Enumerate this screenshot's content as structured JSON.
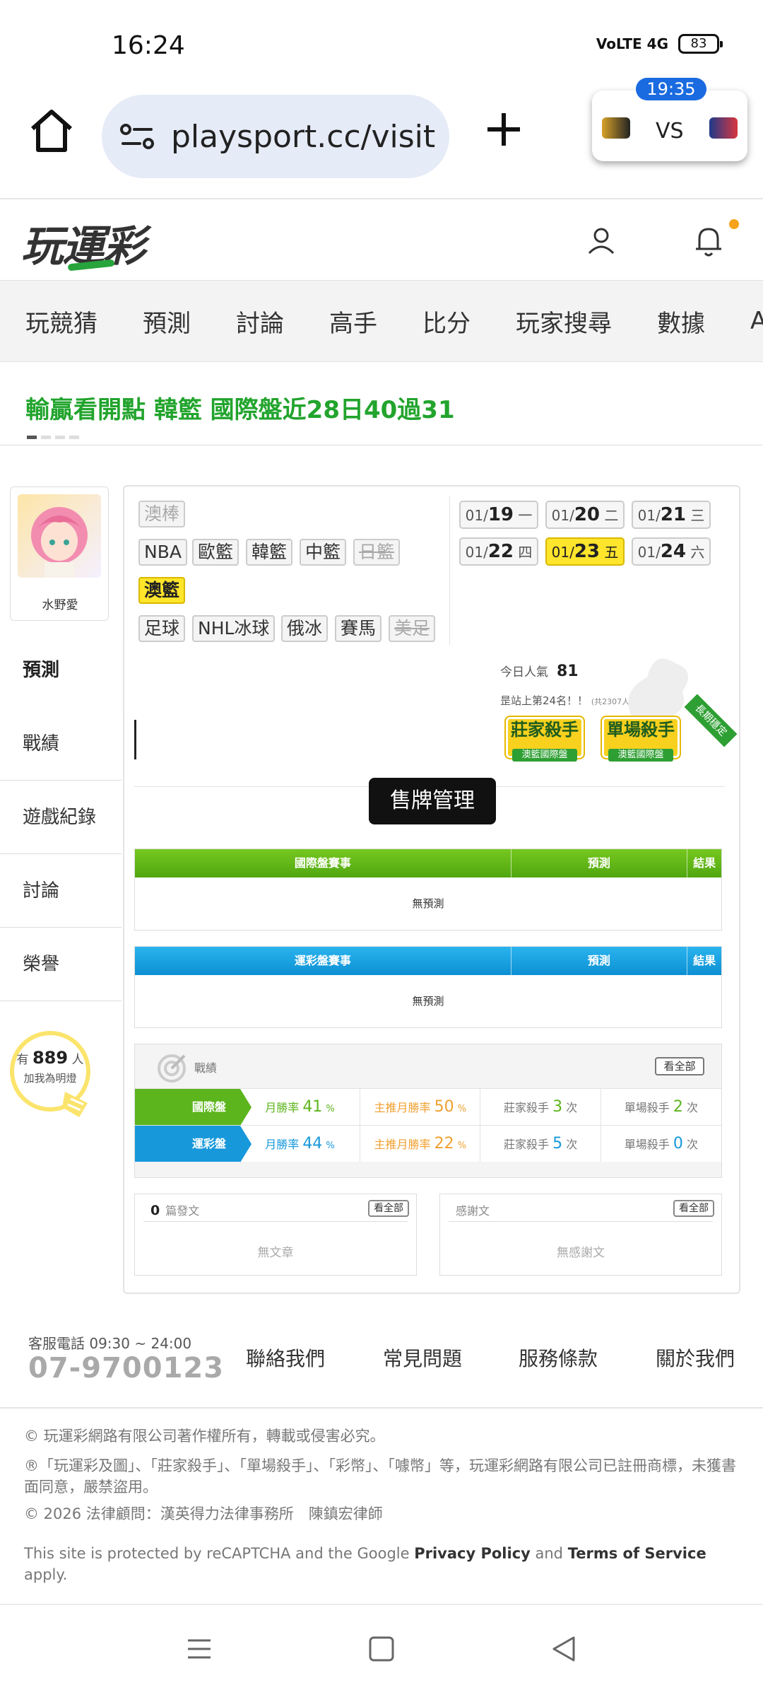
{
  "status_bar": {
    "time": "16:24",
    "network": "VoLTE 4G",
    "battery": "83"
  },
  "browser": {
    "url": "playsport.cc/visit",
    "score_widget": {
      "time": "19:35",
      "vs_label": "VS"
    }
  },
  "site": {
    "logo_text": "玩運彩"
  },
  "nav": {
    "items": [
      "玩競猜",
      "預測",
      "討論",
      "高手",
      "比分",
      "玩家搜尋",
      "數據",
      "APP"
    ]
  },
  "banner": {
    "text": "輸贏看開點 韓籃 國際盤近28日40過31"
  },
  "profile": {
    "name": "水野愛"
  },
  "side_menu": {
    "items": [
      "預測",
      "戰績",
      "遊戲紀錄",
      "討論",
      "榮譽"
    ]
  },
  "fans": {
    "prefix": "有",
    "count": "889",
    "suffix": "人",
    "cta": "加我為明燈"
  },
  "sports": {
    "row1": [
      "澳棒"
    ],
    "row2": [
      "NBA",
      "歐籃",
      "韓籃",
      "中籃",
      "日籃"
    ],
    "row3": [
      "澳籃"
    ],
    "row4": [
      "足球",
      "NHL冰球",
      "俄冰",
      "賽馬",
      "美足"
    ]
  },
  "dates": [
    {
      "md": "01/",
      "d": "19",
      "w": "一"
    },
    {
      "md": "01/",
      "d": "20",
      "w": "二"
    },
    {
      "md": "01/",
      "d": "21",
      "w": "三"
    },
    {
      "md": "01/",
      "d": "22",
      "w": "四"
    },
    {
      "md": "01/",
      "d": "23",
      "w": "五"
    },
    {
      "md": "01/",
      "d": "24",
      "w": "六"
    }
  ],
  "popularity": {
    "label": "今日人氣",
    "value": "81",
    "rank": "昰站上第24名！！",
    "rank_total": "(共2307人)"
  },
  "awards": [
    {
      "title": "莊家殺手",
      "sub": "澳籃國際盤"
    },
    {
      "title": "單場殺手",
      "sub": "澳籃國際盤"
    }
  ],
  "long_stable": "長期穩定",
  "sell_button": "售牌管理",
  "international_table": {
    "col1": "國際盤賽事",
    "col2": "預測",
    "col3": "結果",
    "empty": "無預測"
  },
  "sports_lottery_table": {
    "col1": "運彩盤賽事",
    "col2": "預測",
    "col3": "結果",
    "empty": "無預測"
  },
  "stats": {
    "title": "戰績",
    "see_all": "看全部",
    "rows": [
      {
        "label": "國際盤",
        "monthly_label": "月勝率",
        "monthly_value": "41",
        "pct": "%",
        "main_label": "主推月勝率",
        "main_value": "50",
        "banker_label": "莊家殺手",
        "banker_value": "3",
        "times": "次",
        "single_label": "單場殺手",
        "single_value": "2"
      },
      {
        "label": "運彩盤",
        "monthly_label": "月勝率",
        "monthly_value": "44",
        "pct": "%",
        "main_label": "主推月勝率",
        "main_value": "22",
        "banker_label": "莊家殺手",
        "banker_value": "5",
        "times": "次",
        "single_label": "單場殺手",
        "single_value": "0"
      }
    ]
  },
  "posts": {
    "count": "0",
    "label": "篇發文",
    "see_all": "看全部",
    "empty": "無文章"
  },
  "thanks": {
    "label": "感謝文",
    "see_all": "看全部",
    "empty": "無感謝文"
  },
  "footer": {
    "hours": "客服電話 09:30 ~ 24:00",
    "phone": "07-9700123",
    "links": [
      "聯絡我們",
      "常見問題",
      "服務條款",
      "關於我們"
    ],
    "legal1": "© 玩運彩網路有限公司著作權所有，轉載或侵害必究。",
    "legal2": "®「玩運彩及圖」、「莊家殺手」、「單場殺手」、「彩幣」、「噱幣」等，玩運彩網路有限公司已註冊商標，未獲書面同意，嚴禁盜用。",
    "legal3": "© 2026 法律顧問：漢英得力法律事務所　陳鎮宏律師",
    "recaptcha_pre": "This site is protected by reCAPTCHA and the Google ",
    "privacy": "Privacy Policy",
    "and": " and ",
    "terms": "Terms of Service",
    "apply": " apply."
  },
  "colors": {
    "green": "#22a42d",
    "blue": "#1798da",
    "yellow": "#ffe52b",
    "orange": "#f0a030"
  }
}
